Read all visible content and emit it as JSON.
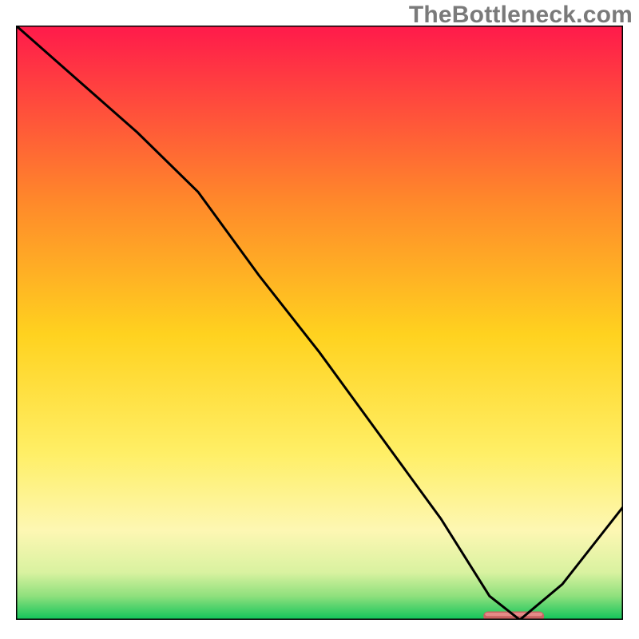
{
  "watermark": "TheBottleneck.com",
  "colors": {
    "grad_top": "#ff1a4b",
    "grad_mid1": "#ff8a2a",
    "grad_mid2": "#ffd21f",
    "grad_mid3": "#ffef66",
    "grad_mid4": "#fdf7b3",
    "grad_low1": "#d9f2a0",
    "grad_low2": "#8fe07d",
    "grad_bottom": "#0fc45a",
    "curve": "#000000",
    "marker": "#c86262",
    "marker_highlight": "#f7a7a2",
    "frame": "#000000"
  },
  "chart_data": {
    "type": "line",
    "title": "",
    "xlabel": "",
    "ylabel": "",
    "xlim": [
      0,
      100
    ],
    "ylim": [
      0,
      100
    ],
    "series": [
      {
        "name": "bottleneck-curve",
        "x": [
          0,
          10,
          20,
          30,
          40,
          50,
          60,
          70,
          78,
          83,
          90,
          100
        ],
        "y": [
          100,
          91,
          82,
          72,
          58,
          45,
          31,
          17,
          4,
          0,
          6,
          19
        ]
      }
    ],
    "marker": {
      "name": "optimal-range",
      "x_start": 77,
      "x_end": 87,
      "y": 0.6
    },
    "gradient_stops": [
      {
        "pos": 0.0,
        "color_key": "grad_top"
      },
      {
        "pos": 0.3,
        "color_key": "grad_mid1"
      },
      {
        "pos": 0.52,
        "color_key": "grad_mid2"
      },
      {
        "pos": 0.72,
        "color_key": "grad_mid3"
      },
      {
        "pos": 0.85,
        "color_key": "grad_mid4"
      },
      {
        "pos": 0.92,
        "color_key": "grad_low1"
      },
      {
        "pos": 0.96,
        "color_key": "grad_low2"
      },
      {
        "pos": 1.0,
        "color_key": "grad_bottom"
      }
    ]
  }
}
